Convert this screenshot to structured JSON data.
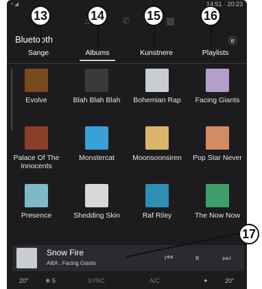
{
  "status": {
    "left": "• ◢",
    "clock": "14:51 · 20:23"
  },
  "header": {
    "title": "Bluetooth",
    "bt_badge": "ʙ"
  },
  "tabs": [
    "Sange",
    "Albums",
    "Kunstnere",
    "Playlists"
  ],
  "active_tab": "Albums",
  "albums": [
    {
      "title": "Evolve",
      "art": "cover-evolve",
      "color": "#7a4b1f"
    },
    {
      "title": "Blah Blah Blah",
      "art": "cover-blah",
      "color": "#3a3a3a"
    },
    {
      "title": "Bohemian Rap",
      "art": "cover-bohemian",
      "color": "#c9ccd2"
    },
    {
      "title": "Facing Giants",
      "art": "cover-facing-giants",
      "color": "#b3a0c8"
    },
    {
      "title": "Palace Of The Innocents",
      "art": "cover-palace",
      "color": "#8b3e2a"
    },
    {
      "title": "Monstercat",
      "art": "cover-monstercat",
      "color": "#3aa0d8"
    },
    {
      "title": "Moonsoonsiren",
      "art": "cover-moonsoonsiren",
      "color": "#d9b46a"
    },
    {
      "title": "Pop Star Never",
      "art": "cover-pop-star",
      "color": "#d48a62"
    },
    {
      "title": "Presence",
      "art": "cover-presence",
      "color": "#7fb8c6"
    },
    {
      "title": "Shedding Skin",
      "art": "cover-shedding-skin",
      "color": "#d8d8d8"
    },
    {
      "title": "Raf Riley",
      "art": "cover-raf-riley",
      "color": "#2c8fb3"
    },
    {
      "title": "The Now Now",
      "art": "cover-now-now",
      "color": "#3e9f6d"
    }
  ],
  "now_playing": {
    "title": "Snow Fire",
    "subtitle": "AlltA . Facing Giants",
    "controls": {
      "prev": "⏮",
      "pause": "⏸",
      "next": "⏭"
    }
  },
  "bottom_bar": {
    "temp_left": "20°",
    "fan": "❄ 5",
    "sync": "SYNC",
    "ac": "A/C",
    "seat": "✦",
    "temp_right": "20°"
  },
  "callouts": [
    "13",
    "14",
    "15",
    "16",
    "17"
  ]
}
